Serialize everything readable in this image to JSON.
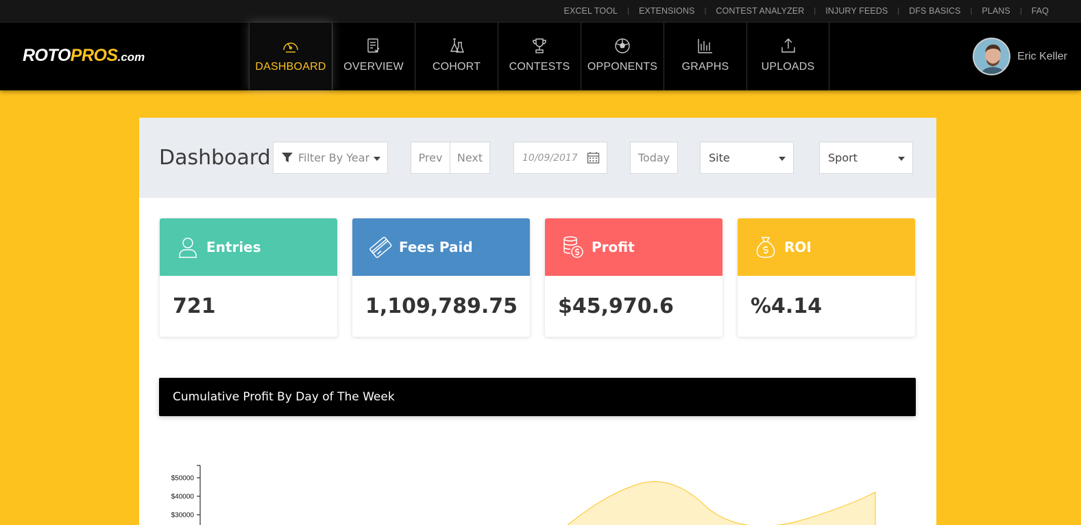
{
  "top_links": [
    "EXCEL TOOL",
    "EXTENSIONS",
    "CONTEST ANALYZER",
    "INJURY FEEDS",
    "DFS BASICS",
    "PLANS",
    "FAQ"
  ],
  "brand": {
    "part1": "ROTO",
    "part2": "PROS",
    "part3": ".com"
  },
  "nav": [
    {
      "label": "DASHBOARD",
      "icon": "speedometer-icon",
      "active": true
    },
    {
      "label": "OVERVIEW",
      "icon": "clipboard-check-icon"
    },
    {
      "label": "COHORT",
      "icon": "flask-icon"
    },
    {
      "label": "CONTESTS",
      "icon": "trophy-icon"
    },
    {
      "label": "OPPONENTS",
      "icon": "soccer-ball-icon"
    },
    {
      "label": "GRAPHS",
      "icon": "bar-graph-icon"
    },
    {
      "label": "UPLOADS",
      "icon": "upload-icon"
    }
  ],
  "user": {
    "name": "Eric Keller"
  },
  "page": {
    "title": "Dashboard"
  },
  "filters": {
    "year_label": "Filter By Year",
    "prev": "Prev",
    "next": "Next",
    "date_placeholder": "10/09/2017",
    "today": "Today",
    "site": "Site",
    "sport": "Sport"
  },
  "cards": [
    {
      "title": "Entries",
      "value": "721",
      "color": "#4fc8ac",
      "icon": "user-icon"
    },
    {
      "title": "Fees Paid",
      "value": "1,109,789.75",
      "color": "#4a8cc6",
      "icon": "credit-card-icon"
    },
    {
      "title": "Profit",
      "value": "$45,970.6",
      "color": "#fe6464",
      "icon": "coins-icon"
    },
    {
      "title": "ROI",
      "value": "%4.14",
      "color": "#fcc024",
      "icon": "money-bag-icon"
    }
  ],
  "chart_panel": {
    "title": "Cumulative Profit By Day of The Week"
  },
  "chart_data": {
    "type": "area",
    "title": "Cumulative Profit By Day of The Week",
    "y_tick_labels": [
      "$50000",
      "$40000",
      "$30000"
    ],
    "y_ticks": [
      50000,
      40000,
      30000
    ],
    "series_color": "#fec21e",
    "series_fill": "#fff1c6"
  }
}
